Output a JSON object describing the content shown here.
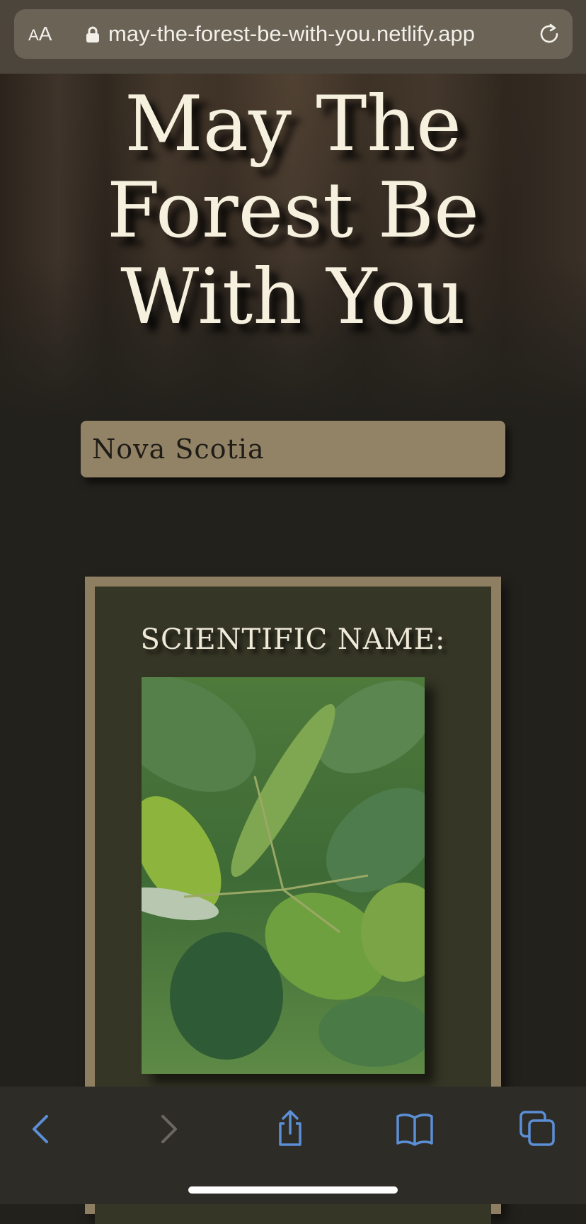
{
  "browser": {
    "text_size_label": "AA",
    "url": "may-the-forest-be-with-you.netlify.app",
    "icons": {
      "lock": "lock-icon",
      "reload": "reload-icon"
    }
  },
  "page": {
    "title_lines": [
      "May The",
      "Forest Be",
      "With You"
    ],
    "region_select": {
      "value": "Nova Scotia"
    },
    "card": {
      "label": "SCIENTIFIC NAME:",
      "image": "leaf-photo"
    }
  },
  "toolbar": {
    "icons": [
      "back-icon",
      "forward-icon",
      "share-icon",
      "bookmarks-icon",
      "tabs-icon"
    ],
    "accent_color": "#5b8fd6",
    "disabled_color": "#6a6760"
  },
  "colors": {
    "background": "#23211c",
    "title": "#f6f0de",
    "select_bg": "#938366",
    "card_frame": "#8f7f62",
    "card_inner": "#363626"
  }
}
